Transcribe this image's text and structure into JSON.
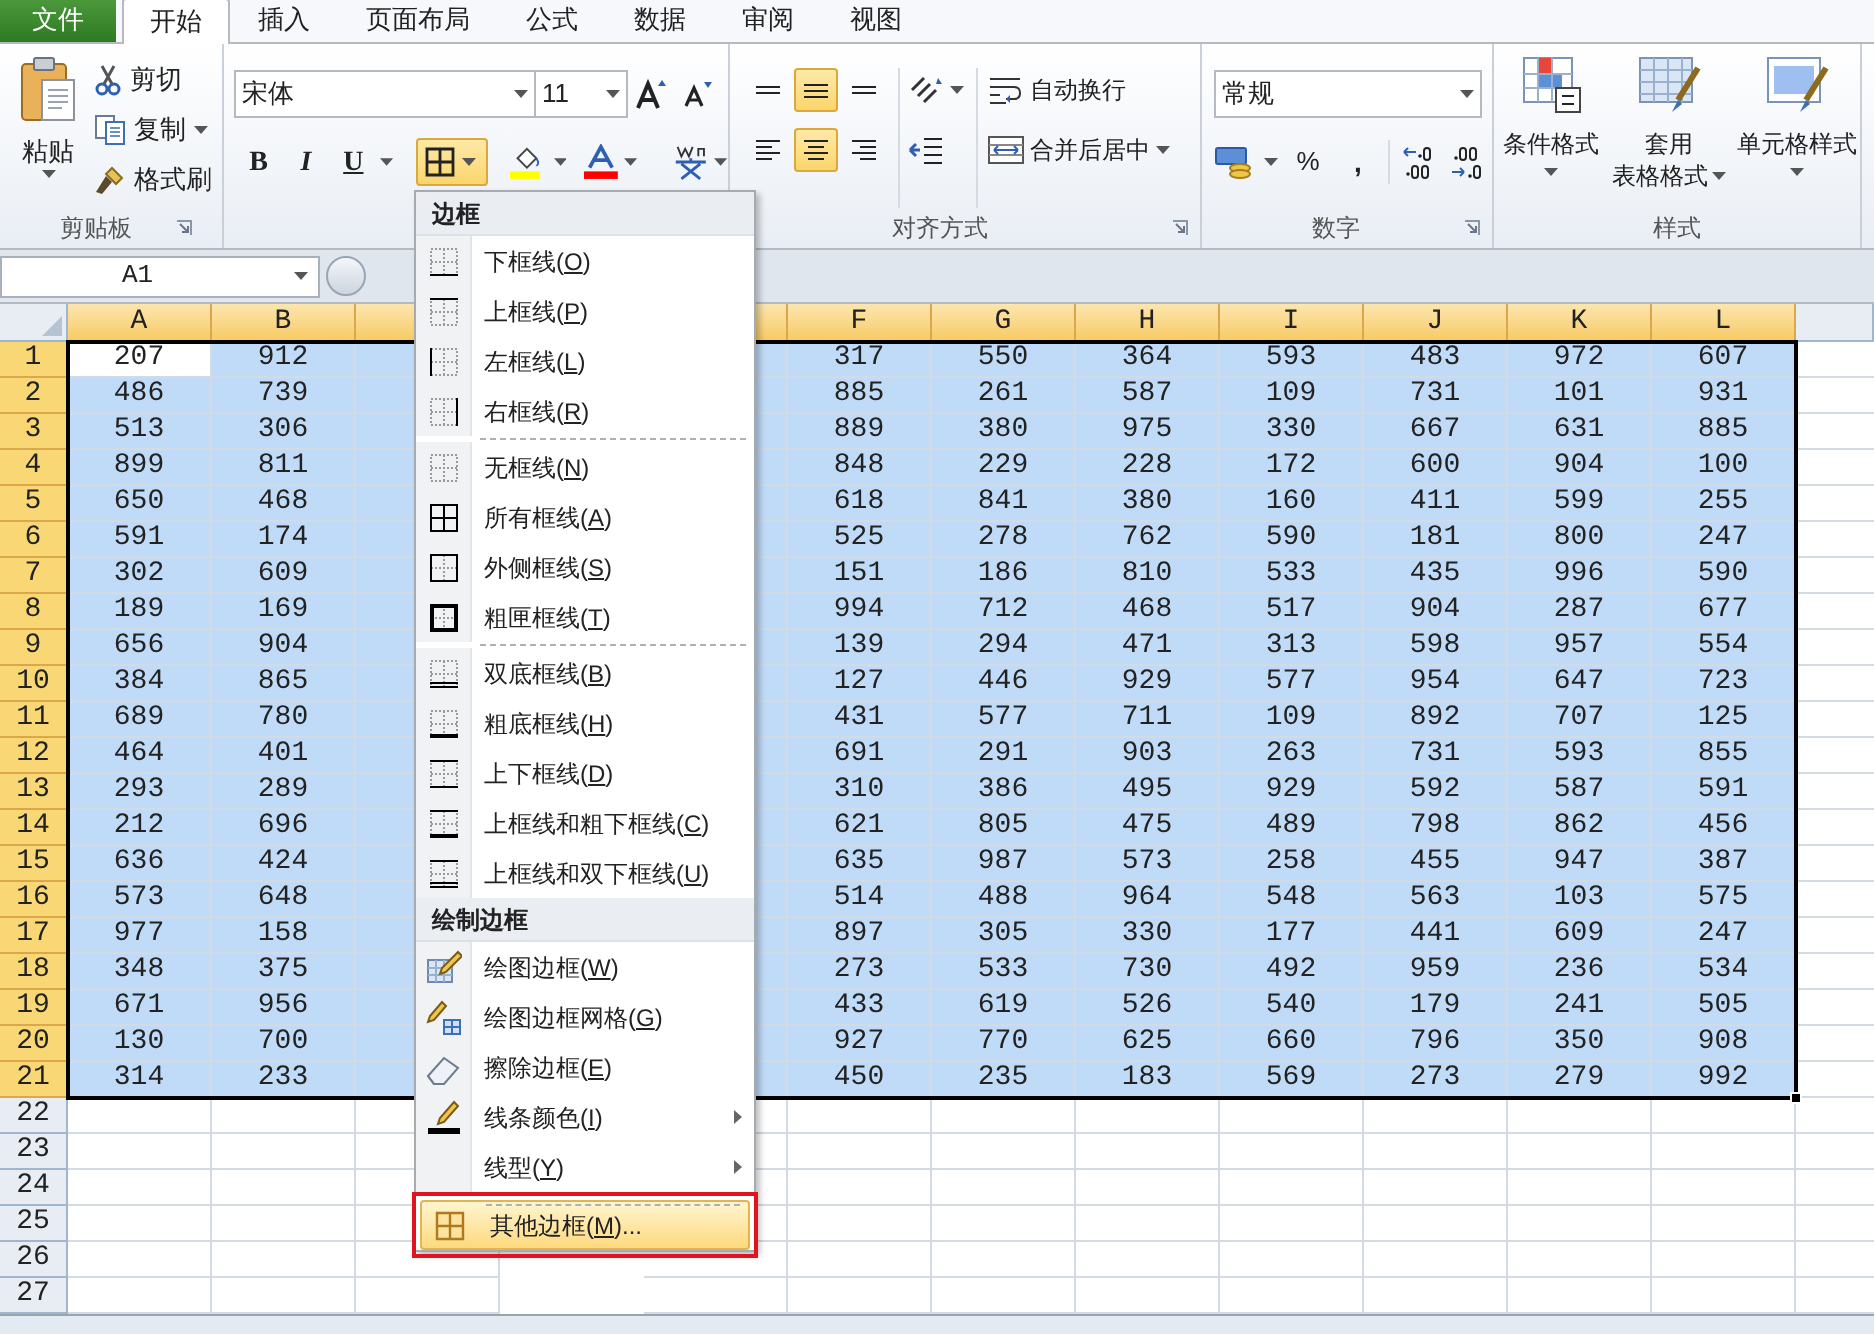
{
  "ribbon_tabs": [
    {
      "label": "文件",
      "kind": "file",
      "selected": false
    },
    {
      "label": "开始",
      "kind": "tab",
      "selected": true
    },
    {
      "label": "插入",
      "kind": "tab",
      "selected": false
    },
    {
      "label": "页面布局",
      "kind": "tab",
      "selected": false
    },
    {
      "label": "公式",
      "kind": "tab",
      "selected": false
    },
    {
      "label": "数据",
      "kind": "tab",
      "selected": false
    },
    {
      "label": "审阅",
      "kind": "tab",
      "selected": false
    },
    {
      "label": "视图",
      "kind": "tab",
      "selected": false
    }
  ],
  "clipboard": {
    "paste": "粘贴",
    "cut": "剪切",
    "copy": "复制",
    "format_painter": "格式刷",
    "label": "剪贴板"
  },
  "font": {
    "name": "宋体",
    "size": "11",
    "bold": "B",
    "italic": "I",
    "underline": "U",
    "borders_expanded": true
  },
  "alignment": {
    "vertical": [
      {
        "selected": false
      },
      {
        "selected": true
      },
      {
        "selected": false
      }
    ],
    "horizontal": [
      {
        "selected": false
      },
      {
        "selected": true
      },
      {
        "selected": false
      }
    ],
    "wrap_text": "自动换行",
    "merge": "合并后居中",
    "label": "对齐方式"
  },
  "number": {
    "format": "常规",
    "percent": "%",
    "comma": ",",
    "label": "数字"
  },
  "styles": {
    "conditional": "条件格式",
    "format_as_table": [
      "套用",
      "表格格式"
    ],
    "cell_styles": "单元格样式",
    "label": "样式"
  },
  "name_box": "A1",
  "sheet": {
    "columns": [
      "A",
      "B",
      "F",
      "G",
      "H",
      "I",
      "J",
      "K",
      "L"
    ],
    "rows": [
      {
        "header": "1",
        "selected": true,
        "cells": [
          "207",
          "912",
          "317",
          "550",
          "364",
          "593",
          "483",
          "972",
          "607"
        ]
      },
      {
        "header": "2",
        "selected": true,
        "cells": [
          "486",
          "739",
          "885",
          "261",
          "587",
          "109",
          "731",
          "101",
          "931"
        ]
      },
      {
        "header": "3",
        "selected": true,
        "cells": [
          "513",
          "306",
          "889",
          "380",
          "975",
          "330",
          "667",
          "631",
          "885"
        ]
      },
      {
        "header": "4",
        "selected": true,
        "cells": [
          "899",
          "811",
          "848",
          "229",
          "228",
          "172",
          "600",
          "904",
          "100"
        ]
      },
      {
        "header": "5",
        "selected": true,
        "cells": [
          "650",
          "468",
          "618",
          "841",
          "380",
          "160",
          "411",
          "599",
          "255"
        ]
      },
      {
        "header": "6",
        "selected": true,
        "cells": [
          "591",
          "174",
          "525",
          "278",
          "762",
          "590",
          "181",
          "800",
          "247"
        ]
      },
      {
        "header": "7",
        "selected": true,
        "cells": [
          "302",
          "609",
          "151",
          "186",
          "810",
          "533",
          "435",
          "996",
          "590"
        ]
      },
      {
        "header": "8",
        "selected": true,
        "cells": [
          "189",
          "169",
          "994",
          "712",
          "468",
          "517",
          "904",
          "287",
          "677"
        ]
      },
      {
        "header": "9",
        "selected": true,
        "cells": [
          "656",
          "904",
          "139",
          "294",
          "471",
          "313",
          "598",
          "957",
          "554"
        ]
      },
      {
        "header": "10",
        "selected": true,
        "cells": [
          "384",
          "865",
          "127",
          "446",
          "929",
          "577",
          "954",
          "647",
          "723"
        ]
      },
      {
        "header": "11",
        "selected": true,
        "cells": [
          "689",
          "780",
          "431",
          "577",
          "711",
          "109",
          "892",
          "707",
          "125"
        ]
      },
      {
        "header": "12",
        "selected": true,
        "cells": [
          "464",
          "401",
          "691",
          "291",
          "903",
          "263",
          "731",
          "593",
          "855"
        ]
      },
      {
        "header": "13",
        "selected": true,
        "cells": [
          "293",
          "289",
          "310",
          "386",
          "495",
          "929",
          "592",
          "587",
          "591"
        ]
      },
      {
        "header": "14",
        "selected": true,
        "cells": [
          "212",
          "696",
          "621",
          "805",
          "475",
          "489",
          "798",
          "862",
          "456"
        ]
      },
      {
        "header": "15",
        "selected": true,
        "cells": [
          "636",
          "424",
          "635",
          "987",
          "573",
          "258",
          "455",
          "947",
          "387"
        ]
      },
      {
        "header": "16",
        "selected": true,
        "cells": [
          "573",
          "648",
          "514",
          "488",
          "964",
          "548",
          "563",
          "103",
          "575"
        ]
      },
      {
        "header": "17",
        "selected": true,
        "cells": [
          "977",
          "158",
          "897",
          "305",
          "330",
          "177",
          "441",
          "609",
          "247"
        ]
      },
      {
        "header": "18",
        "selected": true,
        "cells": [
          "348",
          "375",
          "273",
          "533",
          "730",
          "492",
          "959",
          "236",
          "534"
        ]
      },
      {
        "header": "19",
        "selected": true,
        "cells": [
          "671",
          "956",
          "433",
          "619",
          "526",
          "540",
          "179",
          "241",
          "505"
        ]
      },
      {
        "header": "20",
        "selected": true,
        "cells": [
          "130",
          "700",
          "927",
          "770",
          "625",
          "660",
          "796",
          "350",
          "908"
        ]
      },
      {
        "header": "21",
        "selected": true,
        "cells": [
          "314",
          "233",
          "450",
          "235",
          "183",
          "569",
          "273",
          "279",
          "992"
        ]
      },
      {
        "header": "22",
        "selected": false
      },
      {
        "header": "23",
        "selected": false
      },
      {
        "header": "24",
        "selected": false
      },
      {
        "header": "25",
        "selected": false
      },
      {
        "header": "26",
        "selected": false
      },
      {
        "header": "27",
        "selected": false
      }
    ]
  },
  "border_menu": {
    "sections": [
      {
        "title": "边框",
        "items": [
          {
            "label": "下框线(O)",
            "kind": "bottom",
            "selected": false,
            "separator_before": false,
            "submenu": false,
            "callout": false
          },
          {
            "label": "上框线(P)",
            "kind": "top",
            "selected": false,
            "separator_before": false,
            "submenu": false,
            "callout": false
          },
          {
            "label": "左框线(L)",
            "kind": "left",
            "selected": false,
            "separator_before": false,
            "submenu": false,
            "callout": false
          },
          {
            "label": "右框线(R)",
            "kind": "right",
            "selected": false,
            "separator_before": false,
            "submenu": false,
            "callout": false
          },
          {
            "label": "无框线(N)",
            "kind": "none",
            "selected": false,
            "separator_before": true,
            "submenu": false,
            "callout": false
          },
          {
            "label": "所有框线(A)",
            "kind": "all",
            "selected": false,
            "separator_before": false,
            "submenu": false,
            "callout": false
          },
          {
            "label": "外侧框线(S)",
            "kind": "outside",
            "selected": false,
            "separator_before": false,
            "submenu": false,
            "callout": false
          },
          {
            "label": "粗匣框线(T)",
            "kind": "thick_box",
            "selected": false,
            "separator_before": false,
            "submenu": false,
            "callout": false
          },
          {
            "label": "双底框线(B)",
            "kind": "double_bottom",
            "selected": false,
            "separator_before": true,
            "submenu": false,
            "callout": false
          },
          {
            "label": "粗底框线(H)",
            "kind": "thick_bottom",
            "selected": false,
            "separator_before": false,
            "submenu": false,
            "callout": false
          },
          {
            "label": "上下框线(D)",
            "kind": "top_bottom",
            "selected": false,
            "separator_before": false,
            "submenu": false,
            "callout": false
          },
          {
            "label": "上框线和粗下框线(C)",
            "kind": "top_thick_bottom",
            "selected": false,
            "separator_before": false,
            "submenu": false,
            "callout": false
          },
          {
            "label": "上框线和双下框线(U)",
            "kind": "top_double_bottom",
            "selected": false,
            "separator_before": false,
            "submenu": false,
            "callout": false
          }
        ]
      },
      {
        "title": "绘制边框",
        "items": [
          {
            "label": "绘图边框(W)",
            "kind": "draw",
            "selected": false,
            "separator_before": false,
            "submenu": false,
            "callout": false
          },
          {
            "label": "绘图边框网格(G)",
            "kind": "draw_grid",
            "selected": false,
            "separator_before": false,
            "submenu": false,
            "callout": false
          },
          {
            "label": "擦除边框(E)",
            "kind": "erase",
            "selected": false,
            "separator_before": false,
            "submenu": false,
            "callout": false
          },
          {
            "label": "线条颜色(I)",
            "kind": "line_color",
            "selected": false,
            "separator_before": false,
            "submenu": true,
            "callout": false
          },
          {
            "label": "线型(Y)",
            "selected": false,
            "separator_before": false,
            "submenu": true,
            "callout": false
          },
          {
            "label": "其他边框(M)...",
            "kind": "more",
            "selected": true,
            "separator_before": true,
            "submenu": false,
            "callout": true
          }
        ]
      }
    ]
  }
}
